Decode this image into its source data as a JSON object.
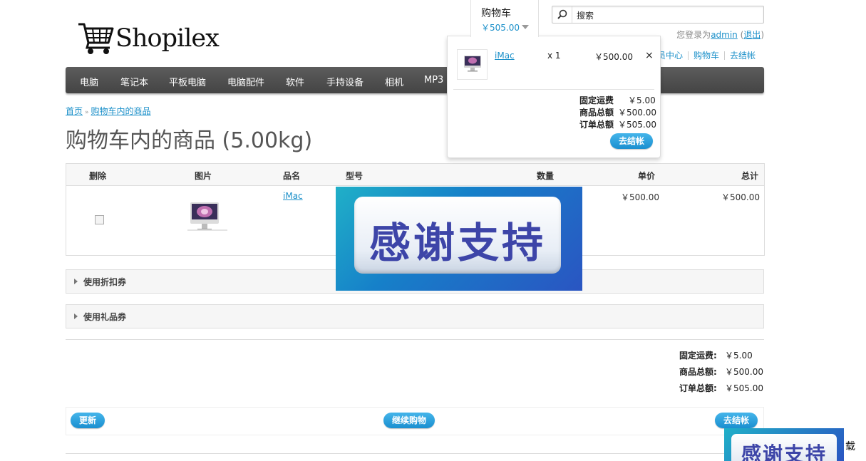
{
  "header": {
    "logo_text": "Shopilex",
    "cart_tab": {
      "title": "购物车",
      "amount": "￥505.00"
    },
    "search": {
      "value": "搜索"
    },
    "login": {
      "prefix": "您登录为",
      "user": "admin",
      "open": " (",
      "logout": "退出",
      "close": ")"
    },
    "links": [
      "员中心",
      "购物车",
      "去结帐"
    ]
  },
  "nav": {
    "items": [
      "电脑",
      "笔记本",
      "平板电脑",
      "电脑配件",
      "软件",
      "手持设备",
      "相机",
      "MP3"
    ]
  },
  "breadcrumb": {
    "home": "首页",
    "sep": "»",
    "current": "购物车内的商品"
  },
  "page": {
    "title": "购物车内的商品  (5.00kg)"
  },
  "table": {
    "headers": {
      "delete": "删除",
      "image": "图片",
      "name": "品名",
      "model": "型号",
      "qty": "数量",
      "price": "单价",
      "total": "总计"
    },
    "rows": [
      {
        "name": "iMac",
        "price": "￥500.00",
        "total": "￥500.00"
      }
    ]
  },
  "accordions": [
    "使用折扣券",
    "使用礼品券"
  ],
  "totals": {
    "labels": [
      "固定运费:",
      "商品总额:",
      "订单总额:"
    ],
    "values": [
      "￥5.00",
      "￥500.00",
      "￥505.00"
    ]
  },
  "buttons": {
    "update": "更新",
    "continue": "继续购物",
    "checkout": "去结帐"
  },
  "mini_cart": {
    "item": {
      "name": "iMac",
      "qty": "x 1",
      "price": "￥500.00",
      "remove": "×"
    },
    "labels": [
      "固定运费",
      "商品总额",
      "订单总额"
    ],
    "values": [
      "￥5.00",
      "￥500.00",
      "￥505.00"
    ],
    "checkout": "去结帐"
  },
  "overlay": {
    "text": "感谢支持"
  },
  "overlay_small": {
    "text": "感谢支持"
  },
  "edge_text": "载"
}
